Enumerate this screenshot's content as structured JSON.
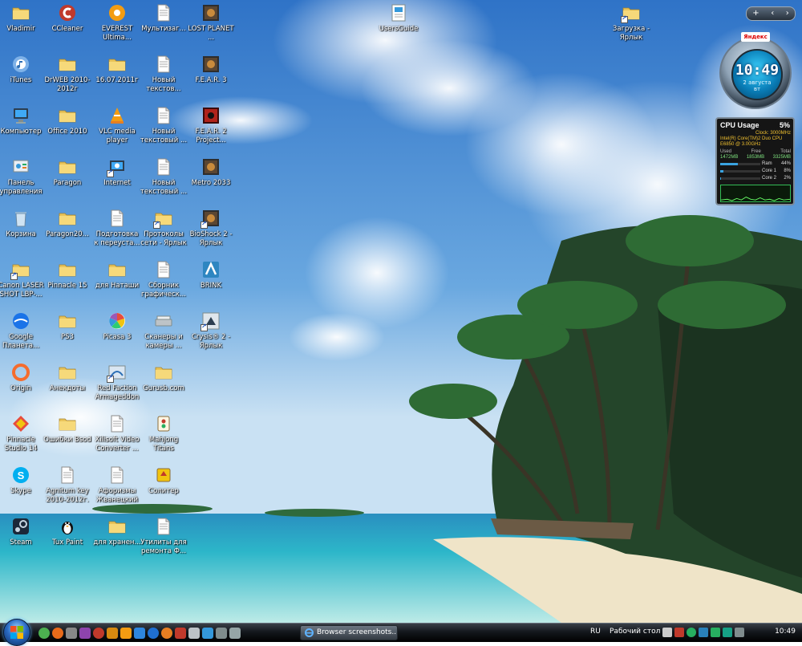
{
  "desktop_icons": [
    {
      "label": "Vladimir",
      "glyph": "folder",
      "shortcut": false
    },
    {
      "label": "iTunes",
      "glyph": "itunes",
      "shortcut": false
    },
    {
      "label": "Компьютер",
      "glyph": "computer",
      "shortcut": false
    },
    {
      "label": "Панель управления",
      "glyph": "control-panel",
      "shortcut": false
    },
    {
      "label": "Корзина",
      "glyph": "recycle-bin",
      "shortcut": false
    },
    {
      "label": "Canon LASER SHOT LBP-...",
      "glyph": "folder",
      "shortcut": true
    },
    {
      "label": "Google Планета...",
      "glyph": "google-earth",
      "shortcut": false
    },
    {
      "label": "Origin",
      "glyph": "origin",
      "shortcut": false
    },
    {
      "label": "Pinnacle Studio 14",
      "glyph": "pinnacle",
      "shortcut": false
    },
    {
      "label": "Skype",
      "glyph": "skype",
      "shortcut": false
    },
    {
      "label": "Steam",
      "glyph": "steam",
      "shortcut": false
    },
    {
      "label": "CCleaner",
      "glyph": "ccleaner",
      "shortcut": false
    },
    {
      "label": "DrWEB 2010-2012г",
      "glyph": "folder",
      "shortcut": false
    },
    {
      "label": "Office 2010",
      "glyph": "folder",
      "shortcut": false
    },
    {
      "label": "Paragon",
      "glyph": "folder",
      "shortcut": false
    },
    {
      "label": "Paragon20...",
      "glyph": "folder",
      "shortcut": false
    },
    {
      "label": "Pinnacle 15",
      "glyph": "folder",
      "shortcut": false
    },
    {
      "label": "PS3",
      "glyph": "folder",
      "shortcut": false
    },
    {
      "label": "Анекдоты",
      "glyph": "folder",
      "shortcut": false
    },
    {
      "label": "Ошибки Bsod",
      "glyph": "folder",
      "shortcut": false
    },
    {
      "label": "Agnitum key 2010-2012г.",
      "glyph": "document",
      "shortcut": false
    },
    {
      "label": "Tux Paint",
      "glyph": "tux",
      "shortcut": false
    },
    {
      "label": "EVEREST Ultima...",
      "glyph": "everest",
      "shortcut": false
    },
    {
      "label": "16.07.2011г",
      "glyph": "folder",
      "shortcut": false
    },
    {
      "label": "VLC media player",
      "glyph": "vlc",
      "shortcut": false
    },
    {
      "label": "Internet",
      "glyph": "internet",
      "shortcut": true
    },
    {
      "label": "Подготовка к переуста...",
      "glyph": "document",
      "shortcut": false
    },
    {
      "label": "для Наташи",
      "glyph": "folder",
      "shortcut": false
    },
    {
      "label": "Picasa 3",
      "glyph": "picasa",
      "shortcut": false
    },
    {
      "label": "Red Faction Armageddon",
      "glyph": "redfaction",
      "shortcut": true
    },
    {
      "label": "Xilisoft Video Converter ...",
      "glyph": "document",
      "shortcut": false
    },
    {
      "label": "Афоризмы Жванецкий",
      "glyph": "document",
      "shortcut": false
    },
    {
      "label": "для хранен...",
      "glyph": "folder",
      "shortcut": false
    },
    {
      "label": "Мультизаг...",
      "glyph": "document",
      "shortcut": false
    },
    {
      "label": "Новый текстов...",
      "glyph": "document",
      "shortcut": false
    },
    {
      "label": "Новый текстовый ...",
      "glyph": "document",
      "shortcut": false
    },
    {
      "label": "Новый текстовый ...",
      "glyph": "document",
      "shortcut": false
    },
    {
      "label": "Протоколы сети - Ярлык",
      "glyph": "folder",
      "shortcut": true
    },
    {
      "label": "Сборник графическ...",
      "glyph": "document",
      "shortcut": false
    },
    {
      "label": "Сканеры и камеры ...",
      "glyph": "scanner",
      "shortcut": false
    },
    {
      "label": "Gurusb.com",
      "glyph": "folder",
      "shortcut": false
    },
    {
      "label": "Mahjong Titans",
      "glyph": "mahjong",
      "shortcut": false
    },
    {
      "label": "Солитер",
      "glyph": "solitaire",
      "shortcut": false
    },
    {
      "label": "Утилиты для ремонта Ф...",
      "glyph": "document",
      "shortcut": false
    },
    {
      "label": "LOST PLANET ...",
      "glyph": "game",
      "shortcut": false
    },
    {
      "label": "F.E.A.R. 3",
      "glyph": "game",
      "shortcut": false
    },
    {
      "label": "F.E.A.R. 2 Project...",
      "glyph": "game-red",
      "shortcut": false
    },
    {
      "label": "Metro 2033",
      "glyph": "game",
      "shortcut": false
    },
    {
      "label": "BioShock 2 - Ярлык",
      "glyph": "game",
      "shortcut": true
    },
    {
      "label": "BRINK",
      "glyph": "brink",
      "shortcut": false
    },
    {
      "label": "Crysis® 2 - Ярлык",
      "glyph": "crysis",
      "shortcut": true
    },
    {
      "label": "UsersGuide",
      "glyph": "usersguide",
      "shortcut": false
    },
    {
      "label": "Загрузка - Ярлык",
      "glyph": "folder",
      "shortcut": true
    }
  ],
  "gadgets": {
    "clock": {
      "brand": "Яндекс",
      "time": "10:49",
      "date": "2 августа",
      "weekday": "вт"
    },
    "cpu": {
      "title": "CPU Usage",
      "percent": "5%",
      "clock": "Clock: 3000MHz",
      "name": "Intel(R) Core(TM)2 Duo CPU E6850 @ 3.00GHz",
      "mem_headers": [
        "Used",
        "Free",
        "Total"
      ],
      "mem_values": [
        "1472MB",
        "1853MB",
        "3325MB"
      ],
      "rows": [
        {
          "name": "Ram",
          "value": "44%",
          "level": 0.44
        },
        {
          "name": "Core 1",
          "value": "8%",
          "level": 0.08
        },
        {
          "name": "Core 2",
          "value": "2%",
          "level": 0.02
        }
      ]
    }
  },
  "taskbar": {
    "task_button": "Browser screenshots...",
    "language": "RU",
    "desktop_toolbar": "Рабочий стол",
    "clock": "10:49"
  },
  "colors": {
    "sky_top": "#3d7ed0",
    "sky_bottom": "#b6d7f1",
    "sea": "#29b0cc",
    "sand": "#f0e6cf",
    "taskbar": "#111519"
  }
}
